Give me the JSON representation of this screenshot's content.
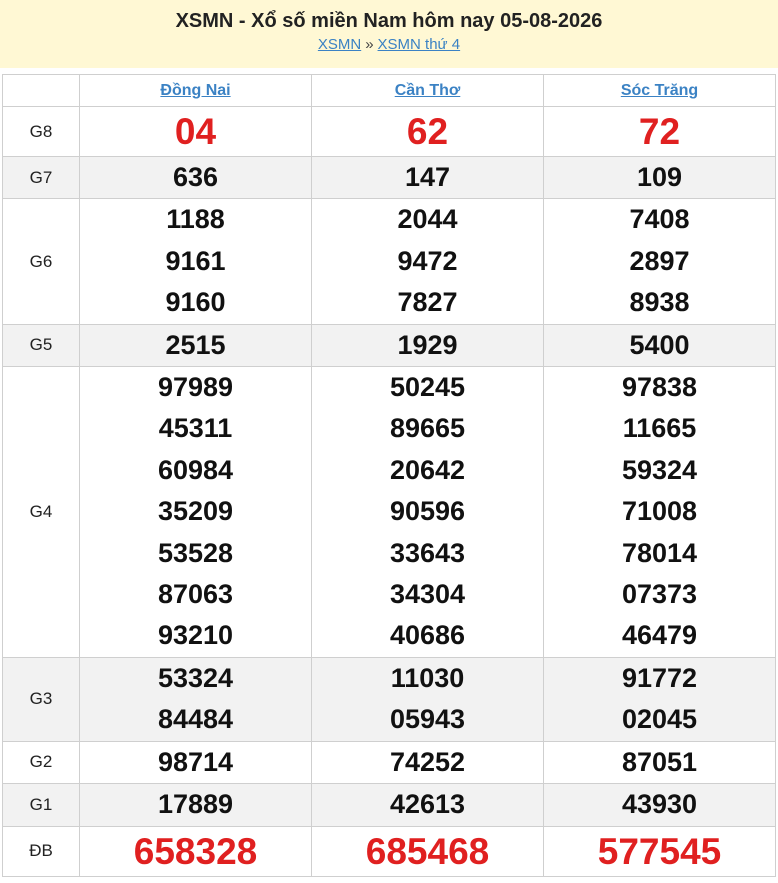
{
  "header": {
    "title": "XSMN - Xổ số miền Nam hôm nay 05-08-2026",
    "breadcrumb_1": "XSMN",
    "breadcrumb_sep": "»",
    "breadcrumb_2": "XSMN thứ 4"
  },
  "provinces": [
    "Đồng Nai",
    "Cần Thơ",
    "Sóc Trăng"
  ],
  "prizes": {
    "g8": {
      "label": "G8",
      "values": [
        "04",
        "62",
        "72"
      ]
    },
    "g7": {
      "label": "G7",
      "values": [
        "636",
        "147",
        "109"
      ]
    },
    "g6": {
      "label": "G6",
      "values": [
        [
          "1188",
          "9161",
          "9160"
        ],
        [
          "2044",
          "9472",
          "7827"
        ],
        [
          "7408",
          "2897",
          "8938"
        ]
      ]
    },
    "g5": {
      "label": "G5",
      "values": [
        "2515",
        "1929",
        "5400"
      ]
    },
    "g4": {
      "label": "G4",
      "values": [
        [
          "97989",
          "45311",
          "60984",
          "35209",
          "53528",
          "87063",
          "93210"
        ],
        [
          "50245",
          "89665",
          "20642",
          "90596",
          "33643",
          "34304",
          "40686"
        ],
        [
          "97838",
          "11665",
          "59324",
          "71008",
          "78014",
          "07373",
          "46479"
        ]
      ]
    },
    "g3": {
      "label": "G3",
      "values": [
        [
          "53324",
          "84484"
        ],
        [
          "11030",
          "05943"
        ],
        [
          "91772",
          "02045"
        ]
      ]
    },
    "g2": {
      "label": "G2",
      "values": [
        "98714",
        "74252",
        "87051"
      ]
    },
    "g1": {
      "label": "G1",
      "values": [
        "17889",
        "42613",
        "43930"
      ]
    },
    "db": {
      "label": "ĐB",
      "values": [
        "658328",
        "685468",
        "577545"
      ]
    }
  },
  "colors": {
    "header_bg": "#fff8d4",
    "link": "#3b82c4",
    "highlight": "#e02020",
    "alt_row": "#f2f2f2"
  }
}
